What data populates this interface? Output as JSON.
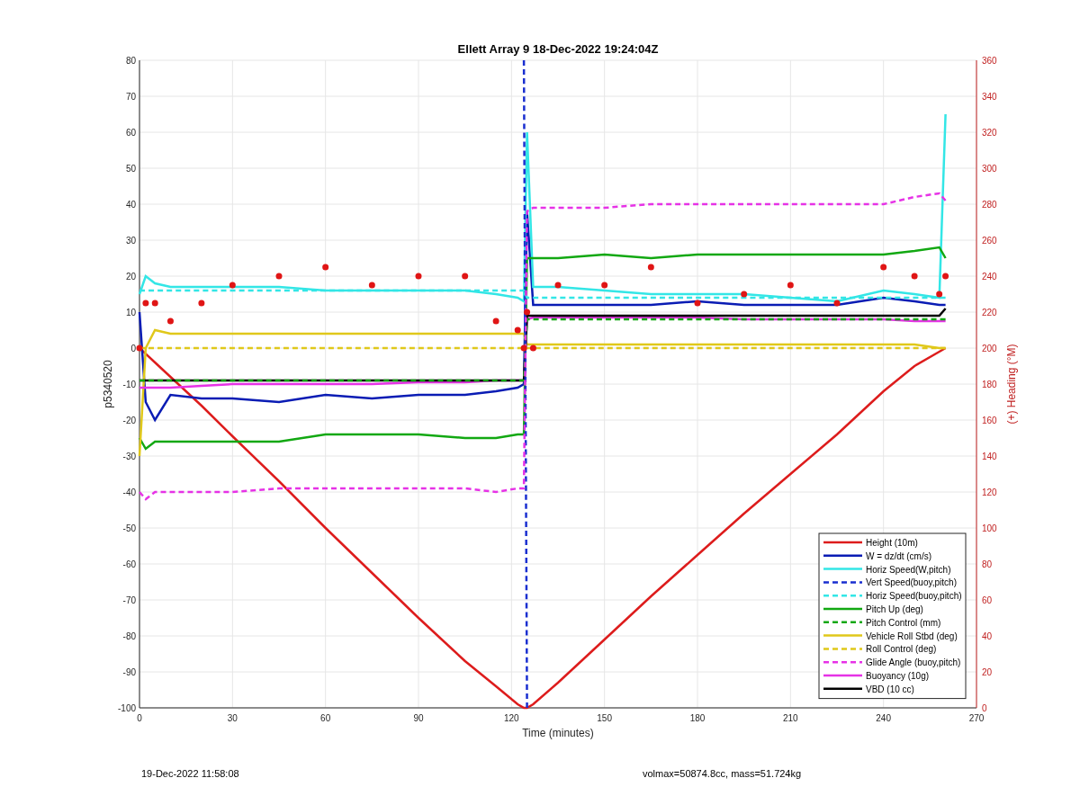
{
  "figure": {
    "footer_left": "19-Dec-2022 11:58:08",
    "footer_right": "volmax=50874.8cc, mass=51.724kg"
  },
  "chart_data": {
    "type": "line",
    "title": "Ellett Array 9 18-Dec-2022 19:24:04Z",
    "xlabel": "Time (minutes)",
    "ylabel": "p5340520",
    "y2label": "(+) Heading (°M)",
    "x": [
      0,
      2,
      5,
      10,
      20,
      30,
      45,
      60,
      75,
      90,
      105,
      115,
      122,
      124,
      125,
      127,
      135,
      150,
      165,
      180,
      195,
      210,
      225,
      240,
      250,
      258,
      260
    ],
    "xlim": [
      0,
      270
    ],
    "ylim": [
      -100,
      80
    ],
    "y2lim": [
      0,
      360
    ],
    "xticks": [
      0,
      30,
      60,
      90,
      120,
      150,
      180,
      210,
      240,
      270
    ],
    "yticks": [
      -100,
      -90,
      -80,
      -70,
      -60,
      -50,
      -40,
      -30,
      -20,
      -10,
      0,
      10,
      20,
      30,
      40,
      50,
      60,
      70,
      80
    ],
    "y2ticks": [
      0,
      20,
      40,
      60,
      80,
      100,
      120,
      140,
      160,
      180,
      200,
      220,
      240,
      260,
      280,
      300,
      320,
      340,
      360
    ],
    "grid": true,
    "legend": true,
    "series": [
      {
        "name": "Height (10m)",
        "color": "#dd1c1c",
        "values": [
          0,
          -1.6,
          -4,
          -8,
          -16,
          -24.5,
          -37,
          -50,
          -62.5,
          -75,
          -87,
          -94,
          -99,
          -100,
          -100,
          -99,
          -93,
          -81,
          -69,
          -57.5,
          -46,
          -35,
          -24,
          -12,
          -5,
          -1,
          0
        ]
      },
      {
        "name": "W = dz/dt (cm/s)",
        "color": "#0a1cb4",
        "values": [
          10,
          -15,
          -20,
          -13,
          -14,
          -14,
          -15,
          -13,
          -14,
          -13,
          -13,
          -12,
          -11,
          -10,
          38,
          12,
          12,
          12,
          12,
          13,
          12,
          12,
          12,
          14,
          13,
          12,
          12
        ]
      },
      {
        "name": "Horiz Speed(W,pitch)",
        "color": "#33e6e6",
        "values": [
          15,
          20,
          18,
          17,
          17,
          17,
          17,
          16,
          16,
          16,
          16,
          15,
          14,
          13,
          60,
          17,
          17,
          16,
          15,
          15,
          15,
          14,
          13,
          16,
          15,
          14,
          65
        ]
      },
      {
        "name": "Vert Speed(buoy,pitch)",
        "color": "#1a2fd0",
        "line_style": "dashed",
        "values": [
          null,
          null,
          null,
          null,
          null,
          null,
          null,
          null,
          null,
          null,
          null,
          null,
          null,
          80,
          -100,
          null,
          null,
          null,
          null,
          null,
          null,
          null,
          null,
          null,
          null,
          null,
          null
        ]
      },
      {
        "name": "Horiz Speed(buoy,pitch)",
        "color": "#33e6e6",
        "line_style": "dashed",
        "values": [
          16,
          16,
          16,
          16,
          16,
          16,
          16,
          16,
          16,
          16,
          16,
          16,
          16,
          16,
          14,
          14,
          14,
          14,
          14,
          14,
          14,
          14,
          14,
          14,
          14,
          14,
          14
        ]
      },
      {
        "name": "Pitch Up (deg)",
        "color": "#12a812",
        "values": [
          -25,
          -28,
          -26,
          -26,
          -26,
          -26,
          -26,
          -24,
          -24,
          -24,
          -25,
          -25,
          -24,
          -24,
          25,
          25,
          25,
          26,
          25,
          26,
          26,
          26,
          26,
          26,
          27,
          28,
          25
        ]
      },
      {
        "name": "Pitch Control (mm)",
        "color": "#12a812",
        "line_style": "dashed",
        "values": [
          -9,
          -9,
          -9,
          -9,
          -9,
          -9,
          -9,
          -9,
          -9,
          -9,
          -9,
          -9,
          -9,
          -9,
          8,
          8,
          8,
          8,
          8,
          8,
          8,
          8,
          8,
          8,
          8,
          8,
          8
        ]
      },
      {
        "name": "Vehicle Roll Stbd (deg)",
        "color": "#e0c81a",
        "values": [
          -30,
          0,
          5,
          4,
          4,
          4,
          4,
          4,
          4,
          4,
          4,
          4,
          4,
          4,
          1,
          1,
          1,
          1,
          1,
          1,
          1,
          1,
          1,
          1,
          1,
          0,
          0
        ]
      },
      {
        "name": "Roll Control (deg)",
        "color": "#e0c81a",
        "line_style": "dashed",
        "values": [
          0,
          0,
          0,
          0,
          0,
          0,
          0,
          0,
          0,
          0,
          0,
          0,
          0,
          0,
          0,
          0,
          0,
          0,
          0,
          0,
          0,
          0,
          0,
          0,
          0,
          0,
          0
        ]
      },
      {
        "name": "Glide Angle (buoy,pitch)",
        "color": "#e632e6",
        "line_style": "dashed",
        "values": [
          -40,
          -42,
          -40,
          -40,
          -40,
          -40,
          -39,
          -39,
          -39,
          -39,
          -39,
          -40,
          -39,
          -39,
          38,
          39,
          39,
          39,
          40,
          40,
          40,
          40,
          40,
          40,
          42,
          43,
          41
        ]
      },
      {
        "name": "Buoyancy (10g)",
        "color": "#e632e6",
        "values": [
          -11,
          -11,
          -11,
          -11,
          -10.5,
          -10,
          -10,
          -10,
          -10,
          -9.5,
          -9.5,
          -9,
          -9,
          -9,
          8,
          8.5,
          8.5,
          8.5,
          8.5,
          8.5,
          8,
          8,
          8,
          8,
          7.5,
          7.5,
          7.5
        ]
      },
      {
        "name": "VBD (10 cc)",
        "color": "#000000",
        "values": [
          -9,
          -9,
          -9,
          -9,
          -9,
          -9,
          -9,
          -9,
          -9,
          -9,
          -9,
          -9,
          -9,
          -9,
          9,
          9,
          9,
          9,
          9,
          9,
          9,
          9,
          9,
          9,
          9,
          9,
          11
        ]
      },
      {
        "color": "#e01515",
        "type": "scatter",
        "axis": "y2",
        "values": [
          200,
          225,
          225,
          215,
          225,
          235,
          240,
          245,
          235,
          240,
          240,
          215,
          210,
          200,
          220,
          200,
          235,
          235,
          245,
          225,
          230,
          235,
          225,
          245,
          240,
          230,
          240
        ]
      }
    ]
  }
}
